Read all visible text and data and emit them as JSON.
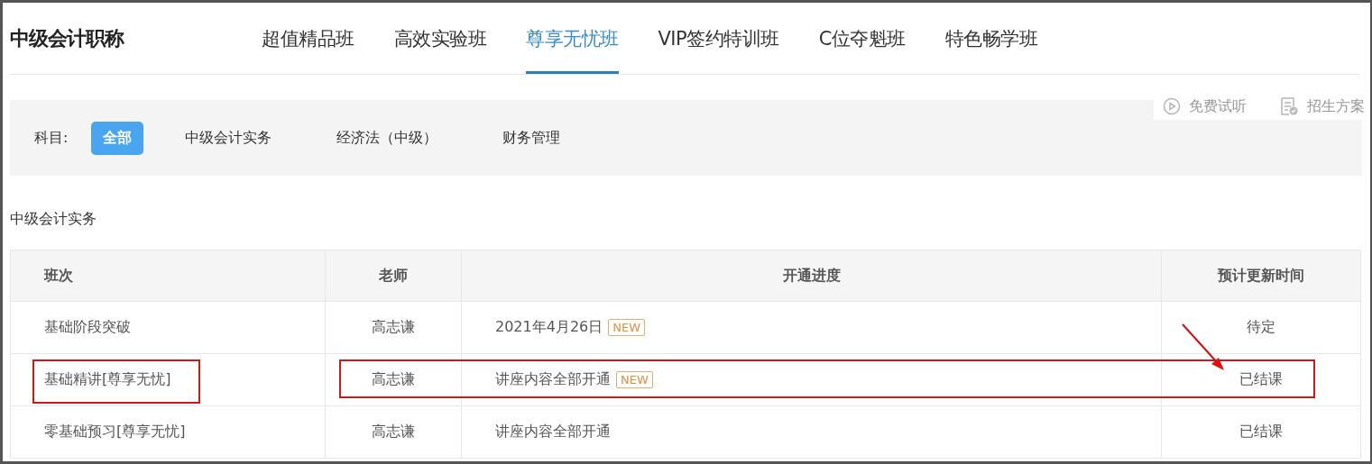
{
  "header": {
    "title": "中级会计职称"
  },
  "tabs": [
    {
      "label": "超值精品班",
      "selected": false
    },
    {
      "label": "高效实验班",
      "selected": false
    },
    {
      "label": "尊享无忧班",
      "selected": true
    },
    {
      "label": "VIP签约特训班",
      "selected": false
    },
    {
      "label": "C位夺魁班",
      "selected": false
    },
    {
      "label": "特色畅学班",
      "selected": false
    }
  ],
  "links": [
    {
      "kind": "play",
      "label": "免费试听"
    },
    {
      "kind": "doc",
      "label": "招生方案"
    }
  ],
  "filter": {
    "label": "科目:",
    "options": [
      {
        "label": "全部",
        "selected": true
      },
      {
        "label": "中级会计实务",
        "selected": false
      },
      {
        "label": "经济法（中级）",
        "selected": false
      },
      {
        "label": "财务管理",
        "selected": false
      }
    ]
  },
  "section_title": "中级会计实务",
  "table": {
    "columns": [
      "班次",
      "老师",
      "开通进度",
      "预计更新时间"
    ],
    "rows": [
      {
        "class": "基础阶段突破",
        "teacher": "高志谦",
        "progress": "2021年4月26日",
        "badge": "NEW",
        "update": "待定",
        "highlighted": false
      },
      {
        "class": "基础精讲[尊享无忧]",
        "teacher": "高志谦",
        "progress": "讲座内容全部开通",
        "badge": "NEW",
        "update": "已结课",
        "highlighted": true
      },
      {
        "class": "零基础预习[尊享无忧]",
        "teacher": "高志谦",
        "progress": "讲座内容全部开通",
        "update": "已结课",
        "highlighted": false
      }
    ]
  }
}
